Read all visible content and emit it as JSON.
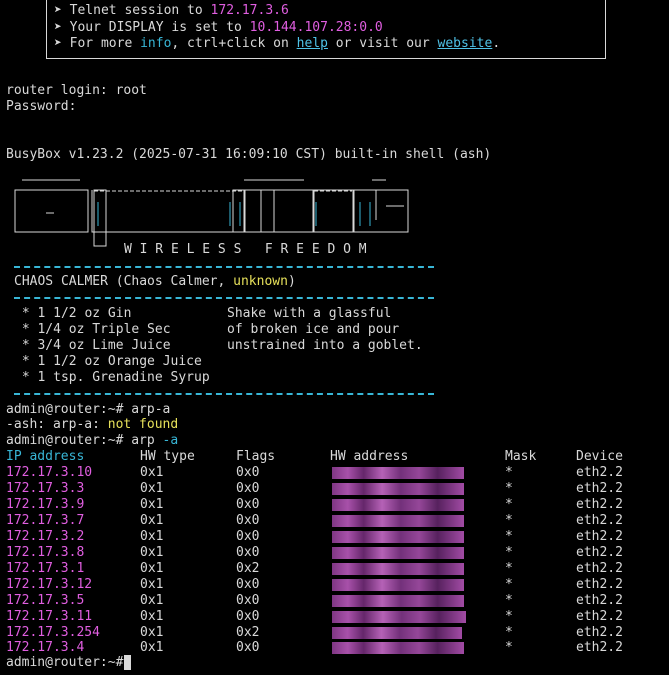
{
  "banner": {
    "telnet_prefix": "➤ Telnet session to ",
    "telnet_ip": "172.17.3.6",
    "display_prefix": "➤ Your DISPLAY is set to ",
    "display_value": "10.144.107.28:0.0",
    "more_prefix": "➤ For more ",
    "info_link": "info",
    "more_mid": ", ctrl+click on ",
    "help_link": "help",
    "more_mid2": " or visit our ",
    "website_link": "website",
    "more_end": "."
  },
  "login": {
    "login_line": "router login: root",
    "password_line": "Password:"
  },
  "busybox_line": "BusyBox v1.23.2 (2025-07-31 16:09:10 CST) built-in shell (ash)",
  "logo_tagline": "W I R E L E S S   F R E E D O M",
  "release": {
    "name_prefix": "CHAOS CALMER (Chaos Calmer, ",
    "name_version": "unknown",
    "name_suffix": ")"
  },
  "recipe": {
    "ingredients": [
      " * 1 1/2 oz Gin",
      " * 1/4 oz Triple Sec",
      " * 3/4 oz Lime Juice",
      " * 1 1/2 oz Orange Juice",
      " * 1 tsp. Grenadine Syrup"
    ],
    "instructions": [
      "Shake with a glassful",
      "of broken ice and pour",
      "unstrained into a goblet."
    ]
  },
  "session": {
    "prompt": "admin@router:~# ",
    "cmd1": "arp-a",
    "error_prefix": "-ash: arp-a: ",
    "error_msg": "not found",
    "cmd2_a": "arp ",
    "cmd2_b": "-a",
    "final_prompt": "admin@router:~# "
  },
  "arp_table": {
    "headers": {
      "ip": "IP address",
      "hw_type": "HW type",
      "flags": "Flags",
      "hw_address": "HW address",
      "mask": "Mask",
      "device": "Device"
    },
    "rows": [
      {
        "ip": "172.17.3.10",
        "hw_type": "0x1",
        "flags": "0x0",
        "mask": "*",
        "device": "eth2.2"
      },
      {
        "ip": "172.17.3.3",
        "hw_type": "0x1",
        "flags": "0x0",
        "mask": "*",
        "device": "eth2.2"
      },
      {
        "ip": "172.17.3.9",
        "hw_type": "0x1",
        "flags": "0x0",
        "mask": "*",
        "device": "eth2.2"
      },
      {
        "ip": "172.17.3.7",
        "hw_type": "0x1",
        "flags": "0x0",
        "mask": "*",
        "device": "eth2.2"
      },
      {
        "ip": "172.17.3.2",
        "hw_type": "0x1",
        "flags": "0x0",
        "mask": "*",
        "device": "eth2.2"
      },
      {
        "ip": "172.17.3.8",
        "hw_type": "0x1",
        "flags": "0x0",
        "mask": "*",
        "device": "eth2.2"
      },
      {
        "ip": "172.17.3.1",
        "hw_type": "0x1",
        "flags": "0x2",
        "mask": "*",
        "device": "eth2.2"
      },
      {
        "ip": "172.17.3.12",
        "hw_type": "0x1",
        "flags": "0x0",
        "mask": "*",
        "device": "eth2.2"
      },
      {
        "ip": "172.17.3.5",
        "hw_type": "0x1",
        "flags": "0x0",
        "mask": "*",
        "device": "eth2.2"
      },
      {
        "ip": "172.17.3.11",
        "hw_type": "0x1",
        "flags": "0x0",
        "mask": "*",
        "device": "eth2.2"
      },
      {
        "ip": "172.17.3.254",
        "hw_type": "0x1",
        "flags": "0x2",
        "mask": "*",
        "device": "eth2.2"
      },
      {
        "ip": "172.17.3.4",
        "hw_type": "0x1",
        "flags": "0x0",
        "mask": "*",
        "device": "eth2.2"
      }
    ]
  },
  "colors": {
    "background": "#000000",
    "foreground": "#d9d9d9",
    "magenta": "#e05ee0",
    "yellow": "#e6e05a",
    "cyan": "#38b6d6"
  }
}
